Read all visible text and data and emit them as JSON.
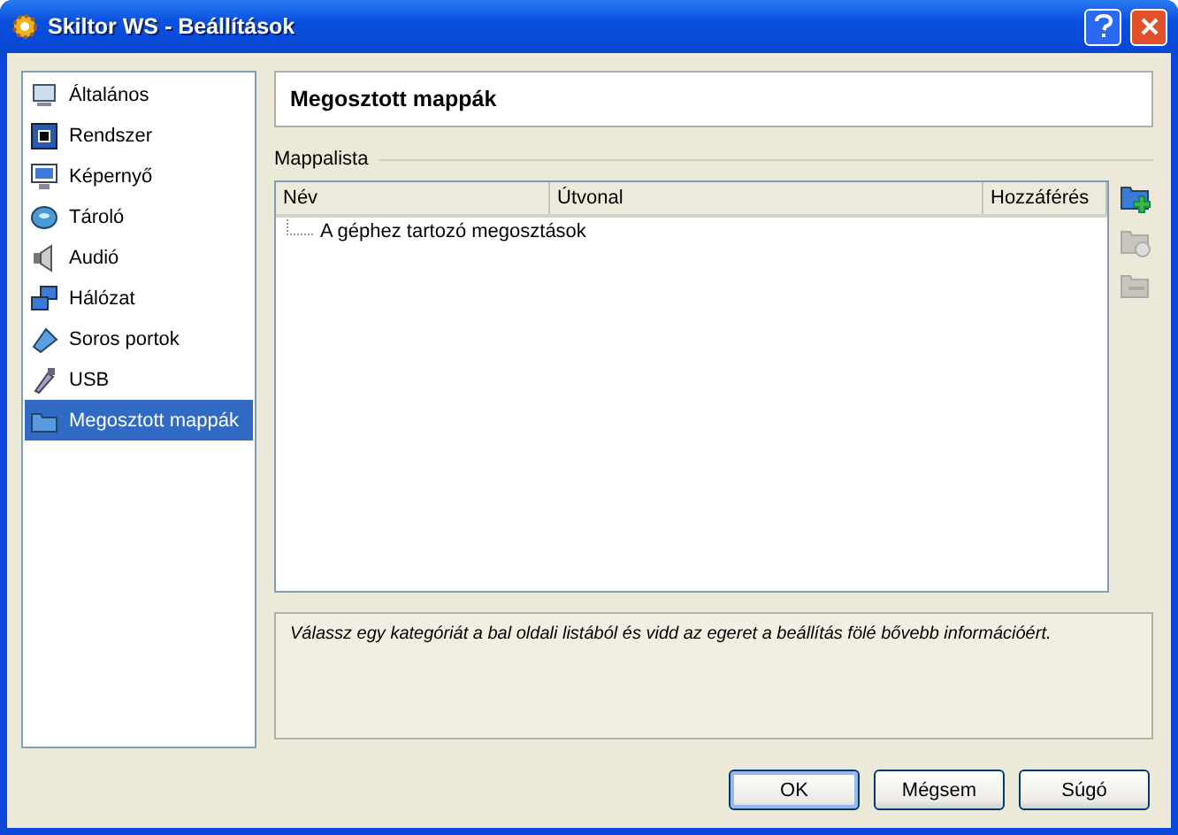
{
  "window": {
    "title": "Skiltor WS - Beállítások"
  },
  "sidebar": {
    "items": [
      {
        "label": "Általános",
        "selected": false
      },
      {
        "label": "Rendszer",
        "selected": false
      },
      {
        "label": "Képernyő",
        "selected": false
      },
      {
        "label": "Tároló",
        "selected": false
      },
      {
        "label": "Audió",
        "selected": false
      },
      {
        "label": "Hálózat",
        "selected": false
      },
      {
        "label": "Soros portok",
        "selected": false
      },
      {
        "label": "USB",
        "selected": false
      },
      {
        "label": "Megosztott mappák",
        "selected": true
      }
    ]
  },
  "page": {
    "title": "Megosztott mappák",
    "group_label": "Mappalista",
    "table": {
      "columns": [
        "Név",
        "Útvonal",
        "Hozzáférés"
      ],
      "rows": [
        {
          "label": "A géphez tartozó megosztások"
        }
      ]
    },
    "tools": [
      {
        "kind": "add",
        "disabled": false
      },
      {
        "kind": "edit",
        "disabled": true
      },
      {
        "kind": "remove",
        "disabled": true
      }
    ]
  },
  "info": {
    "text": "Válassz egy kategóriát a bal oldali listából és vidd az egeret a beállítás fölé bővebb információért."
  },
  "buttons": [
    {
      "label": "OK",
      "default": true
    },
    {
      "label": "Mégsem",
      "default": false
    },
    {
      "label": "Súgó",
      "default": false
    }
  ]
}
